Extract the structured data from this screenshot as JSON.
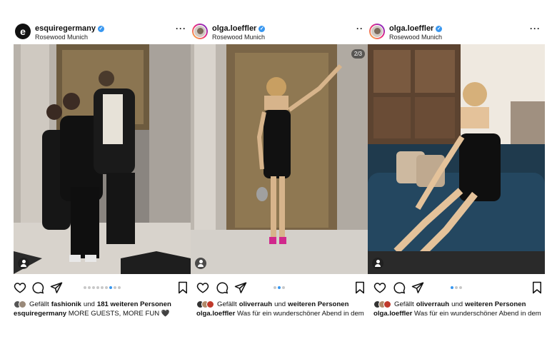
{
  "posts": [
    {
      "username": "esquiregermany",
      "location": "Rosewood Munich",
      "more": "···",
      "likes_prefix": "Gefällt ",
      "likes_user": "fashionik",
      "likes_mid": " und ",
      "likes_count": "181 weiteren Personen",
      "caption_user": "esquiregermany",
      "caption_text": " MORE GUESTS, MORE FUN 🖤",
      "carousel_dots": 9,
      "carousel_active": 6,
      "avatar_letter": "e"
    },
    {
      "username": "olga.loeffler",
      "location": "Rosewood Munich",
      "more": "··",
      "counter": "2/3",
      "likes_prefix": "Gefällt ",
      "likes_user": "oliverrauh",
      "likes_mid": " und ",
      "likes_count": "weiteren Personen",
      "caption_user": "olga.loeffler",
      "caption_text": " Was für ein wunderschöner Abend in dem",
      "carousel_dots": 3,
      "carousel_active": 1
    },
    {
      "username": "olga.loeffler",
      "location": "Rosewood Munich",
      "more": "···",
      "likes_prefix": "Gefällt ",
      "likes_user": "oliverrauh",
      "likes_mid": " und ",
      "likes_count": "weiteren Personen",
      "caption_user": "olga.loeffler",
      "caption_text": " Was für ein wunderschöner Abend in dem",
      "carousel_dots": 3,
      "carousel_active": 0
    }
  ],
  "icons": {
    "like": "heart-icon",
    "comment": "comment-icon",
    "share": "share-icon",
    "save": "bookmark-icon",
    "verified": "verified-badge-icon",
    "tag": "user-tag-icon"
  },
  "colors": {
    "verified": "#3897f0",
    "active_dot": "#3897f0",
    "inactive_dot": "#c8c8c8"
  }
}
